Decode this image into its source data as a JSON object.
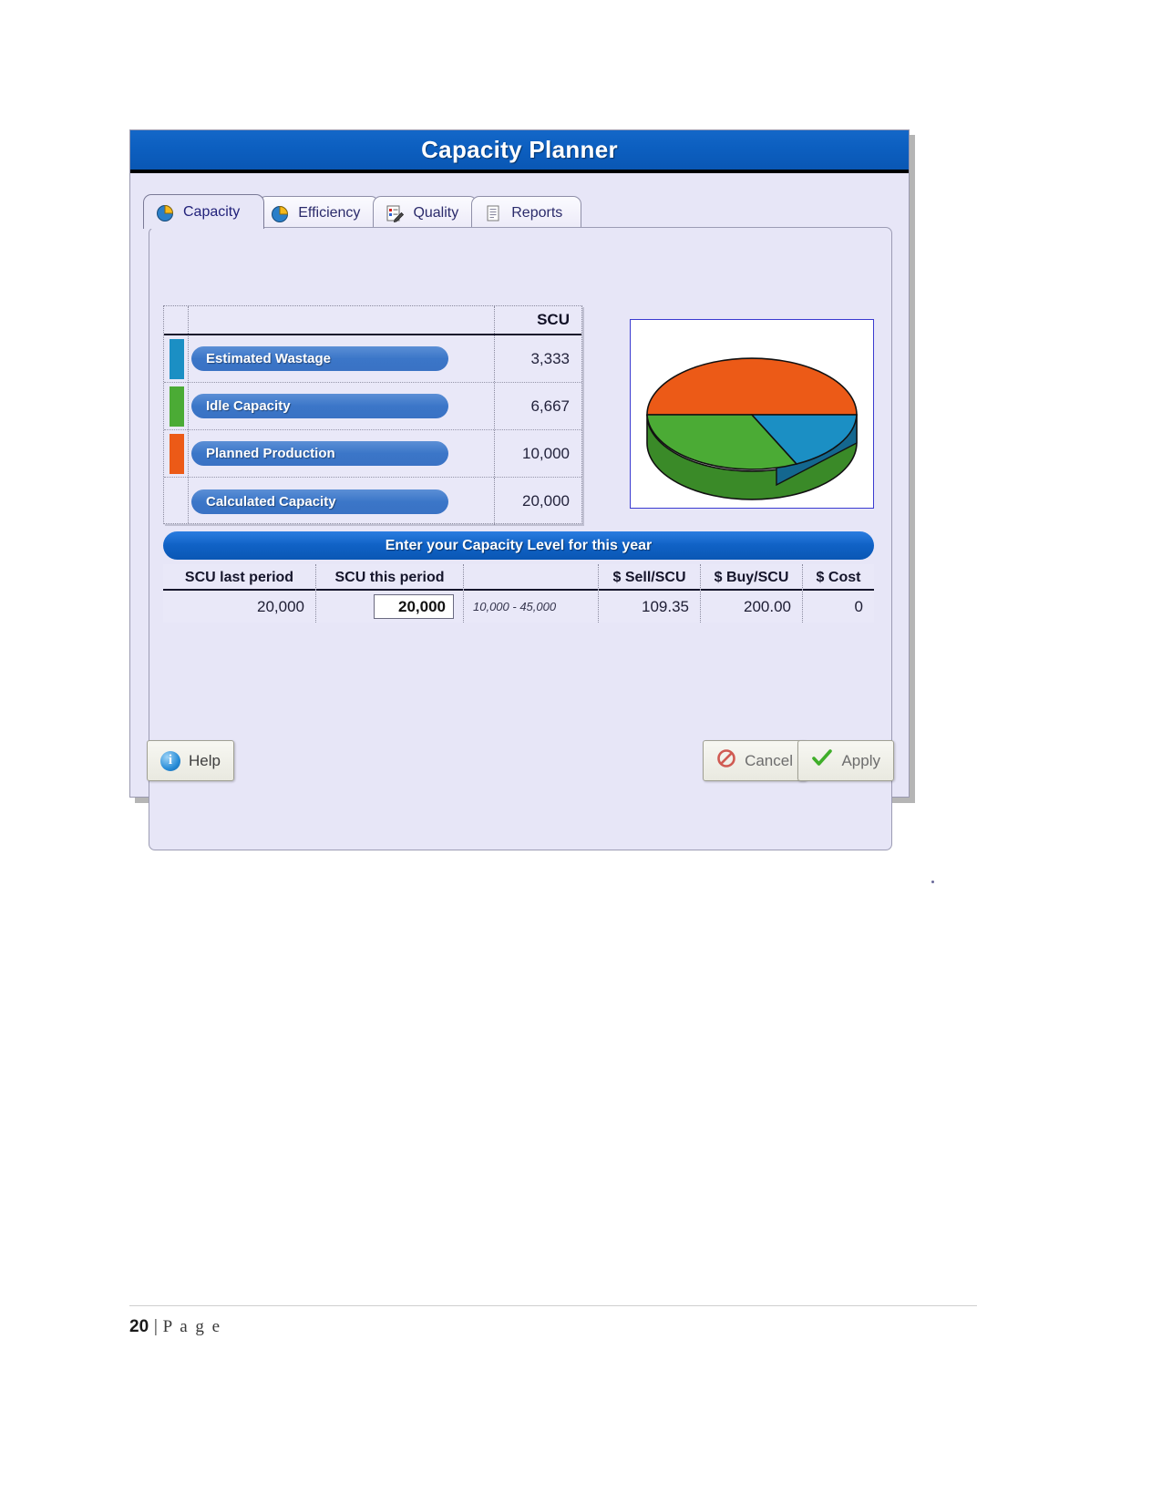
{
  "window": {
    "title": "Capacity Planner"
  },
  "tabs": [
    {
      "label": "Capacity",
      "icon": "pie-chart-icon",
      "active": true
    },
    {
      "label": "Efficiency",
      "icon": "pie-chart-icon",
      "active": false
    },
    {
      "label": "Quality",
      "icon": "quality-edit-icon",
      "active": false
    },
    {
      "label": "Reports",
      "icon": "document-icon",
      "active": false
    }
  ],
  "capacity_table": {
    "value_header": "SCU",
    "rows": [
      {
        "label": "Estimated Wastage",
        "value": "3,333",
        "color": "#1b8fc4"
      },
      {
        "label": "Idle Capacity",
        "value": "6,667",
        "color": "#4bab35"
      },
      {
        "label": "Planned Production",
        "value": "10,000",
        "color": "#ec5a17"
      },
      {
        "label": "Calculated Capacity",
        "value": "20,000",
        "color": "transparent"
      }
    ]
  },
  "chart_data": {
    "type": "pie",
    "title": "",
    "labels": [
      "Planned Production",
      "Idle Capacity",
      "Estimated Wastage"
    ],
    "values": [
      10000,
      6667,
      3333
    ],
    "percentages": [
      50,
      33.3,
      16.7
    ],
    "colors": [
      "#ec5a17",
      "#4bab35",
      "#1b8fc4"
    ],
    "units": "SCU",
    "legend": "none",
    "three_d": true
  },
  "banner": {
    "text": "Enter your Capacity Level for this year"
  },
  "entry_table": {
    "headers": [
      "SCU last period",
      "SCU this period",
      "",
      "$ Sell/SCU",
      "$ Buy/SCU",
      "$ Cost"
    ],
    "values": {
      "scu_last_period": "20,000",
      "scu_this_period": "20,000",
      "range_hint": "10,000 - 45,000",
      "sell_per_scu": "109.35",
      "buy_per_scu": "200.00",
      "cost": "0"
    }
  },
  "footer_buttons": {
    "help": "Help",
    "cancel": "Cancel",
    "apply": "Apply"
  },
  "page_footer": {
    "number": "20",
    "separator": "|",
    "word": "P a g e"
  }
}
